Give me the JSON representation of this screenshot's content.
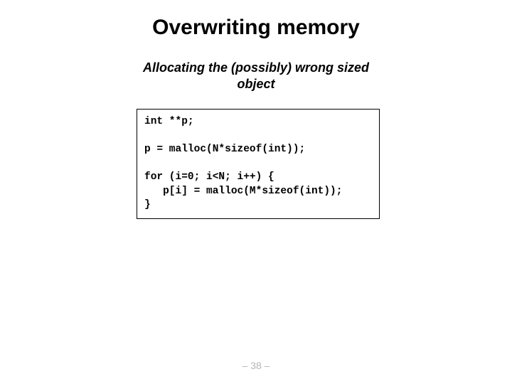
{
  "title": "Overwriting memory",
  "subtitle": "Allocating the (possibly) wrong sized object",
  "code": "int **p;\n\np = malloc(N*sizeof(int));\n\nfor (i=0; i<N; i++) {\n   p[i] = malloc(M*sizeof(int));\n}",
  "page_number": "– 38 –"
}
